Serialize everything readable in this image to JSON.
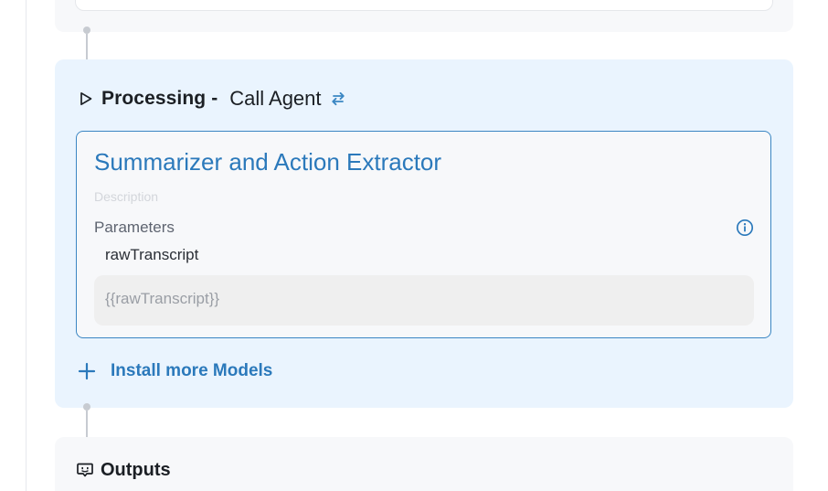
{
  "processing": {
    "title": "Processing",
    "separator": "-",
    "subtitle": "Call Agent",
    "swap_icon": "swap-arrows-icon",
    "play_icon": "play-outline-icon"
  },
  "agent_card": {
    "name": "Summarizer and Action Extractor",
    "description_placeholder": "Description",
    "parameters_label": "Parameters",
    "info_icon": "info-circle-icon",
    "parameter": {
      "name": "rawTranscript",
      "value": "{{rawTranscript}}"
    }
  },
  "install_models": {
    "label": "Install more Models",
    "icon": "plus-icon"
  },
  "outputs": {
    "title": "Outputs",
    "icon": "chat-bot-icon"
  },
  "colors": {
    "accent": "#2b79bb",
    "card_border": "#3a86c3",
    "processing_bg": "#eaf4fe",
    "section_bg": "#f7f8fa"
  }
}
